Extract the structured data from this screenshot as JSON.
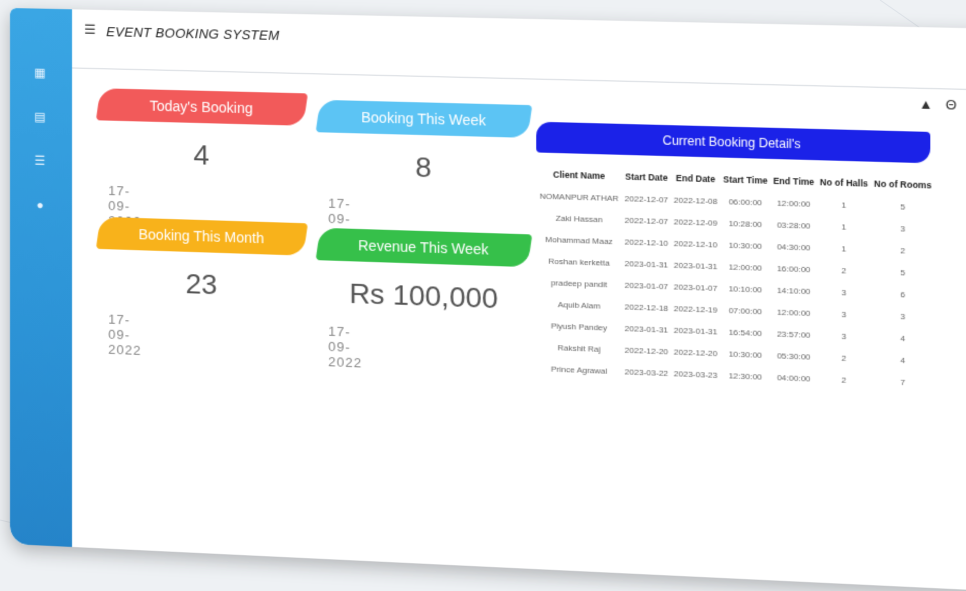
{
  "app": {
    "title": "EVENT BOOKING SYSTEM"
  },
  "sidebar": {
    "items": [
      {
        "name": "dashboard",
        "icon": "dashboard-icon",
        "glyph": "▦"
      },
      {
        "name": "bookings",
        "icon": "book-icon",
        "glyph": "▤"
      },
      {
        "name": "list",
        "icon": "list-icon",
        "glyph": "☰"
      },
      {
        "name": "users",
        "icon": "user-icon",
        "glyph": "●"
      }
    ]
  },
  "header": {
    "icons": [
      {
        "name": "notification-icon",
        "glyph": "▲"
      },
      {
        "name": "account-icon",
        "glyph": "Θ"
      },
      {
        "name": "power-icon",
        "glyph": "⏻"
      }
    ]
  },
  "cards": [
    {
      "label": "Today's Booking",
      "value": "4",
      "date": "17-09-2022",
      "color": "#f25a5a"
    },
    {
      "label": "Booking This Week",
      "value": "8",
      "date": "17-09-2022",
      "color": "#5cc4f4"
    },
    {
      "label": "Booking This Month",
      "value": "23",
      "date": "17-09-2022",
      "color": "#f8b21b"
    },
    {
      "label": "Revenue This Week",
      "value": "Rs 100,000",
      "date": "17-09-2022",
      "color": "#36c04a"
    }
  ],
  "details": {
    "title": "Current Booking Detail's",
    "columns": [
      "Client Name",
      "Start Date",
      "End Date",
      "Start Time",
      "End Time",
      "No of Halls",
      "No of Rooms"
    ],
    "rows": [
      [
        "NOMANPUR ATHAR",
        "2022-12-07",
        "2022-12-08",
        "06:00:00",
        "12:00:00",
        "1",
        "5"
      ],
      [
        "Zaki Hassan",
        "2022-12-07",
        "2022-12-09",
        "10:28:00",
        "03:28:00",
        "1",
        "3"
      ],
      [
        "Mohammad Maaz",
        "2022-12-10",
        "2022-12-10",
        "10:30:00",
        "04:30:00",
        "1",
        "2"
      ],
      [
        "Roshan kerketta",
        "2023-01-31",
        "2023-01-31",
        "12:00:00",
        "16:00:00",
        "2",
        "5"
      ],
      [
        "pradeep pandit",
        "2023-01-07",
        "2023-01-07",
        "10:10:00",
        "14:10:00",
        "3",
        "6"
      ],
      [
        "Aquib Alam",
        "2022-12-18",
        "2022-12-19",
        "07:00:00",
        "12:00:00",
        "3",
        "3"
      ],
      [
        "Piyush Pandey",
        "2023-01-31",
        "2023-01-31",
        "16:54:00",
        "23:57:00",
        "3",
        "4"
      ],
      [
        "Rakshit Raj",
        "2022-12-20",
        "2022-12-20",
        "10:30:00",
        "05:30:00",
        "2",
        "4"
      ],
      [
        "Prince Agrawal",
        "2023-03-22",
        "2023-03-23",
        "12:30:00",
        "04:00:00",
        "2",
        "7"
      ]
    ]
  }
}
